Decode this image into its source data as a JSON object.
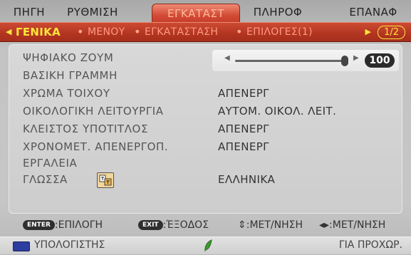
{
  "tabs": [
    {
      "label": "ΠΗΓΗ",
      "active": false
    },
    {
      "label": "ΡΥΘΜΙΣΗ",
      "active": false
    },
    {
      "label": "ΕΓΚΑΤΑΣΤ",
      "active": true
    },
    {
      "label": "ΠΛΗΡΟΦ",
      "active": false
    },
    {
      "label": "ΕΠΑΝΑΦ",
      "active": false
    }
  ],
  "subtabs": [
    {
      "label": "ΓΕΝΙΚΑ",
      "active": true
    },
    {
      "label": "ΜΕΝΟΥ",
      "active": false
    },
    {
      "label": "ΕΓΚΑΤΑΣΤΑΣΗ",
      "active": false
    },
    {
      "label": "ΕΠΙΛΟΓΕΣ(1)",
      "active": false
    }
  ],
  "page_indicator": "1/2",
  "rows": [
    {
      "label": "ΨΗΦΙΑΚΟ ΖΟΥΜ",
      "value": ""
    },
    {
      "label": "ΒΑΣΙΚΗ ΓΡΑΜΜΗ",
      "value": ""
    },
    {
      "label": "ΧΡΩΜΑ ΤΟΙΧΟΥ",
      "value": "ΑΠΕΝΕΡΓ"
    },
    {
      "label": "ΟΙΚΟΛΟΓΙΚΗ ΛΕΙΤΟΥΡΓΙΑ",
      "value": "ΑΥΤΟΜ. ΟΙΚΟΛ. ΛΕΙΤ."
    },
    {
      "label": "ΚΛΕΙΣΤΟΣ ΥΠΟΤΙΤΛΟΣ",
      "value": "ΑΠΕΝΕΡΓ"
    },
    {
      "label": "ΧΡΟΝΟΜΕΤ. ΑΠΕΝΕΡΓΟΠ.",
      "value": "ΑΠΕΝΕΡΓ"
    },
    {
      "label": "ΕΡΓΑΛΕΙΑ",
      "value": ""
    },
    {
      "label": "ΓΛΩΣΣΑ",
      "value": "ΕΛΛΗΝΙΚΑ"
    }
  ],
  "digital_zoom": {
    "value": "100",
    "level_fraction": 1.0
  },
  "help": {
    "enter_key": "ENTER",
    "enter_label": ":ΕΠΙΛΟΓΗ",
    "exit_key": "EXIT",
    "exit_label": ":ΈΞΟΔΟΣ",
    "updown_label": "⇕:ΜΕΤ/ΝΗΣΗ",
    "leftright_label": "◂▸:ΜΕΤ/ΝΗΣΗ"
  },
  "status": {
    "source": "ΥΠΟΛΟΓΙΣΤΗΣ",
    "mode": "ΓΙΑ ΠΡΟΧΩΡ."
  },
  "icons": {
    "source_icon": "monitor-icon",
    "eco_icon": "leaf-icon",
    "language_icon": "language-icon"
  },
  "colors": {
    "accent_red": "#c23a26",
    "highlight_yellow": "#ffe43a"
  }
}
